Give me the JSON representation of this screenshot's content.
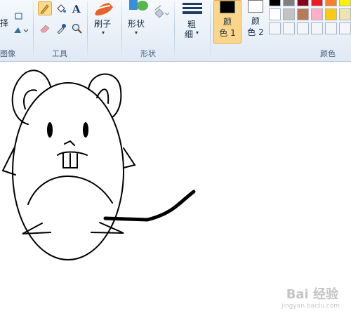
{
  "ribbon": {
    "image_group": {
      "label": "图像",
      "select_fragment": "择"
    },
    "tools_group": {
      "label": "工具"
    },
    "brush": {
      "label": "刷子"
    },
    "shapes_group": {
      "button_label": "形状",
      "label": "形状"
    },
    "size": {
      "line1": "粗",
      "line2": "细"
    },
    "color1": {
      "line1": "颜",
      "line2": "色 1",
      "value": "#000000"
    },
    "color2": {
      "line1": "颜",
      "line2": "色 2",
      "value": "#ffffff"
    },
    "colors_group": {
      "label": "颜色"
    }
  },
  "palette": [
    [
      "#000000",
      "#7f7f7f",
      "#880015",
      "#ed1c24",
      "#ff7f27",
      "#fff200"
    ],
    [
      "#ffffff",
      "#c3c3c3",
      "#b97a57",
      "#ffaec9",
      "#ffc90e",
      "#efe4b0"
    ],
    [
      "#f3f5f8",
      "#f3f5f8",
      "#f3f5f8",
      "#f3f5f8",
      "#f3f5f8",
      "#f3f5f8"
    ]
  ],
  "watermark": {
    "text": "Bai 经验",
    "sub": "jingyan.baidu.com"
  }
}
